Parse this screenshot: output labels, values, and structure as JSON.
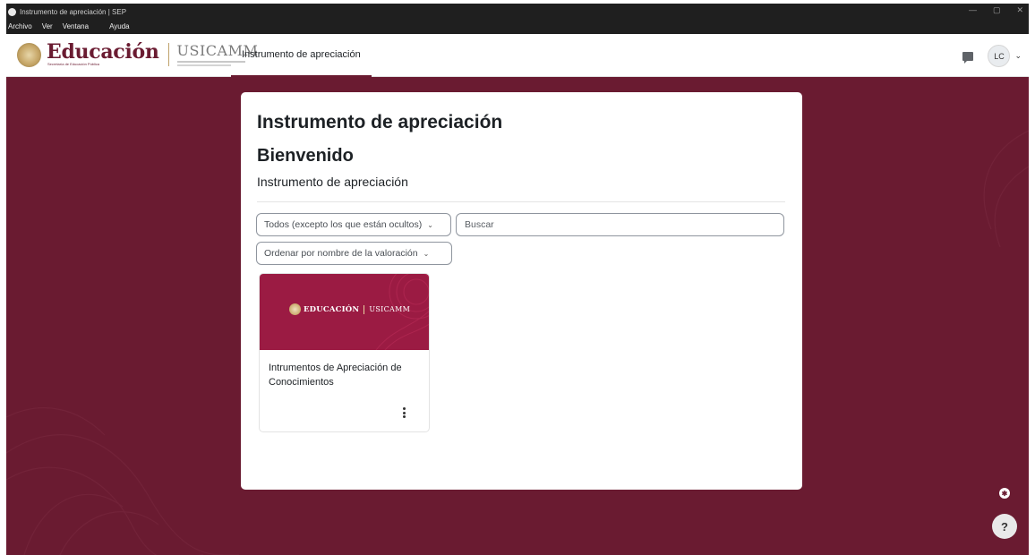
{
  "window": {
    "title": "Instrumento de apreciación | SEP",
    "menu": [
      "Archivo",
      "Ver",
      "Ventana",
      "Ayuda"
    ],
    "controls": [
      "—",
      "▢",
      "✕"
    ]
  },
  "header": {
    "logo_main": "Educación",
    "logo_sub": "Secretaría de Educación Pública",
    "logo_secondary": "USICAMM",
    "nav_tab": "Instrumento de apreciación",
    "avatar_initials": "LC",
    "avatar_caret": "⌄"
  },
  "main": {
    "title": "Instrumento de apreciación",
    "subtitle": "Bienvenido",
    "section_heading": "Instrumento de apreciación",
    "filter_select": "Todos (excepto los que están ocultos)",
    "search_placeholder": "Buscar",
    "sort_select": "Ordenar por nombre de la valoración",
    "courses": [
      {
        "image_brand": "EDUCACIÓN",
        "image_brand_secondary": "USICAMM",
        "title": "Intrumentos de Apreciación de Conocimientos"
      }
    ]
  },
  "floating": {
    "accessibility_icon": "accessibility-icon",
    "help_label": "?"
  },
  "colors": {
    "brand": "#6a1b31",
    "course_image": "#9b1b43",
    "card": "#ffffff"
  }
}
